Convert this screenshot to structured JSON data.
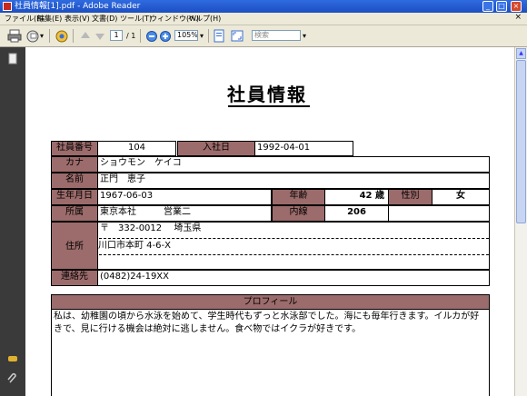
{
  "window": {
    "title": "社員情報[1].pdf - Adobe Reader",
    "btn_min": "_",
    "btn_max": "□",
    "btn_close": "×"
  },
  "menu": {
    "items": [
      "ファイル(F)",
      "編集(E)",
      "表示(V)",
      "文書(D)",
      "ツール(T)",
      "ウィンドウ(W)",
      "ヘルプ(H)"
    ],
    "close_doc": "×"
  },
  "toolbar": {
    "page_current": "1",
    "page_total": "/ 1",
    "zoom": "105%",
    "search_placeholder": "検索"
  },
  "form": {
    "title": "社員情報",
    "labels": {
      "emp_no": "社員番号",
      "hire_date": "入社日",
      "kana": "カナ",
      "name": "名前",
      "birthdate": "生年月日",
      "age": "年齢",
      "gender": "性別",
      "dept": "所属",
      "extension": "内線",
      "address": "住所",
      "contact": "連絡先",
      "profile": "プロフィール"
    },
    "values": {
      "emp_no": "104",
      "hire_date": "1992-04-01",
      "kana": "ショウモン　ケイコ",
      "name": "正門　恵子",
      "birthdate": "1967-06-03",
      "age": "42 歳",
      "gender": "女",
      "dept": "東京本社　　　営業二",
      "extension": "206",
      "address_line1": "〒　332-0012　  埼玉県",
      "address_line2": "川口市本町 4-6-X",
      "contact": "(0482)24-19XX",
      "profile": "私は、幼稚園の頃から水泳を始めて、学生時代もずっと水泳部でした。海にも毎年行きます。イルカが好きで、見に行ける機会は絶対に逃しません。食べ物ではイクラが好きです。"
    }
  }
}
